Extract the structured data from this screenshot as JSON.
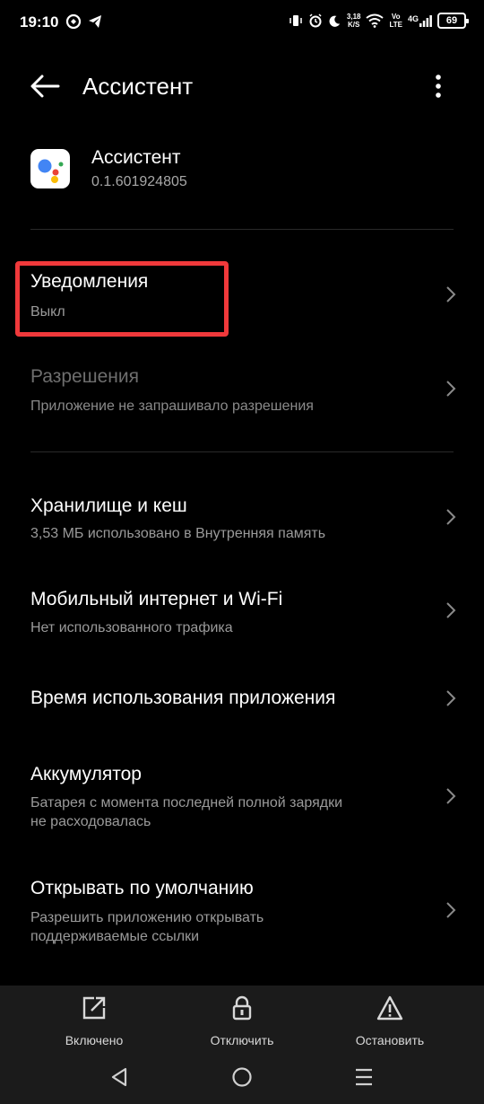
{
  "status_bar": {
    "time": "19:10",
    "speed_value": "3,18",
    "speed_unit": "K/S",
    "volte_top": "Vo",
    "volte_bottom": "LTE",
    "network": "4G",
    "battery": "69"
  },
  "toolbar": {
    "title": "Ассистент"
  },
  "app": {
    "name": "Ассистент",
    "version": "0.1.601924805"
  },
  "items": [
    {
      "title": "Уведомления",
      "subtitle": "Выкл"
    },
    {
      "title": "Разрешения",
      "subtitle": "Приложение не запрашивало разрешения"
    },
    {
      "title": "Хранилище и кеш",
      "subtitle": "3,53 МБ использовано в Внутренняя память"
    },
    {
      "title": "Мобильный интернет и Wi-Fi",
      "subtitle": "Нет использованного трафика"
    },
    {
      "title": "Время использования приложения",
      "subtitle": ""
    },
    {
      "title": "Аккумулятор",
      "subtitle_line1": "Батарея с момента последней полной зарядки",
      "subtitle_line2": "не расходовалась"
    },
    {
      "title": "Открывать по умолчанию",
      "subtitle_line1": "Разрешить приложению открывать",
      "subtitle_line2": "поддерживаемые ссылки"
    }
  ],
  "bottom_actions": {
    "enabled_label": "Включено",
    "disable_label": "Отключить",
    "stop_label": "Остановить"
  },
  "colors": {
    "highlight": "#f0393b",
    "background": "#000000",
    "bar": "#1b1b1b"
  }
}
